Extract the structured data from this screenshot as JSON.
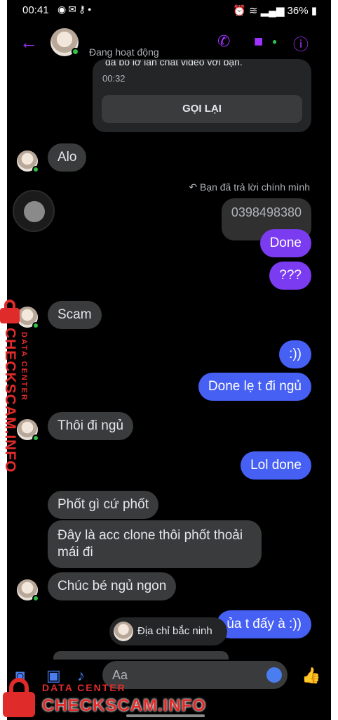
{
  "statusbar": {
    "time": "00:41",
    "left_icons": "messenger,gmail,key,dot",
    "battery": "36%"
  },
  "header": {
    "contact_status": "Đang hoạt động"
  },
  "call_card": {
    "cut_text": "đã bỏ lỡ lần chat video với bạn.",
    "time": "00:32",
    "button_label": "GỌI LẠI"
  },
  "reply_note": "Bạn đã trả lời chính mình",
  "messages": [
    {
      "text": "Alo"
    },
    {
      "text": "0398498380"
    },
    {
      "text": "Done"
    },
    {
      "text": "???"
    },
    {
      "text": "Scam"
    },
    {
      "text": ":))"
    },
    {
      "text": "Done lẹ t đi ngủ"
    },
    {
      "text": "Thôi đi ngủ"
    },
    {
      "text": "Lol done"
    },
    {
      "text": "Phốt gì cứ phốt"
    },
    {
      "text": "Đây là acc clone thôi phốt thoải mái đi"
    },
    {
      "text": "Chúc bé ngủ ngon"
    },
    {
      "text": "ủa t đấy à :))"
    }
  ],
  "mention_chip": "Địa chỉ bắc ninh",
  "composer": {
    "placeholder": "Aa"
  },
  "watermark": {
    "small": "DATA CENTER",
    "big": "CHECKSCAM.INFO"
  },
  "colors": {
    "purple": "#7b3bf0",
    "blue": "#4660f4",
    "accent": "#a033ff",
    "watermark": "#e02b2b"
  }
}
